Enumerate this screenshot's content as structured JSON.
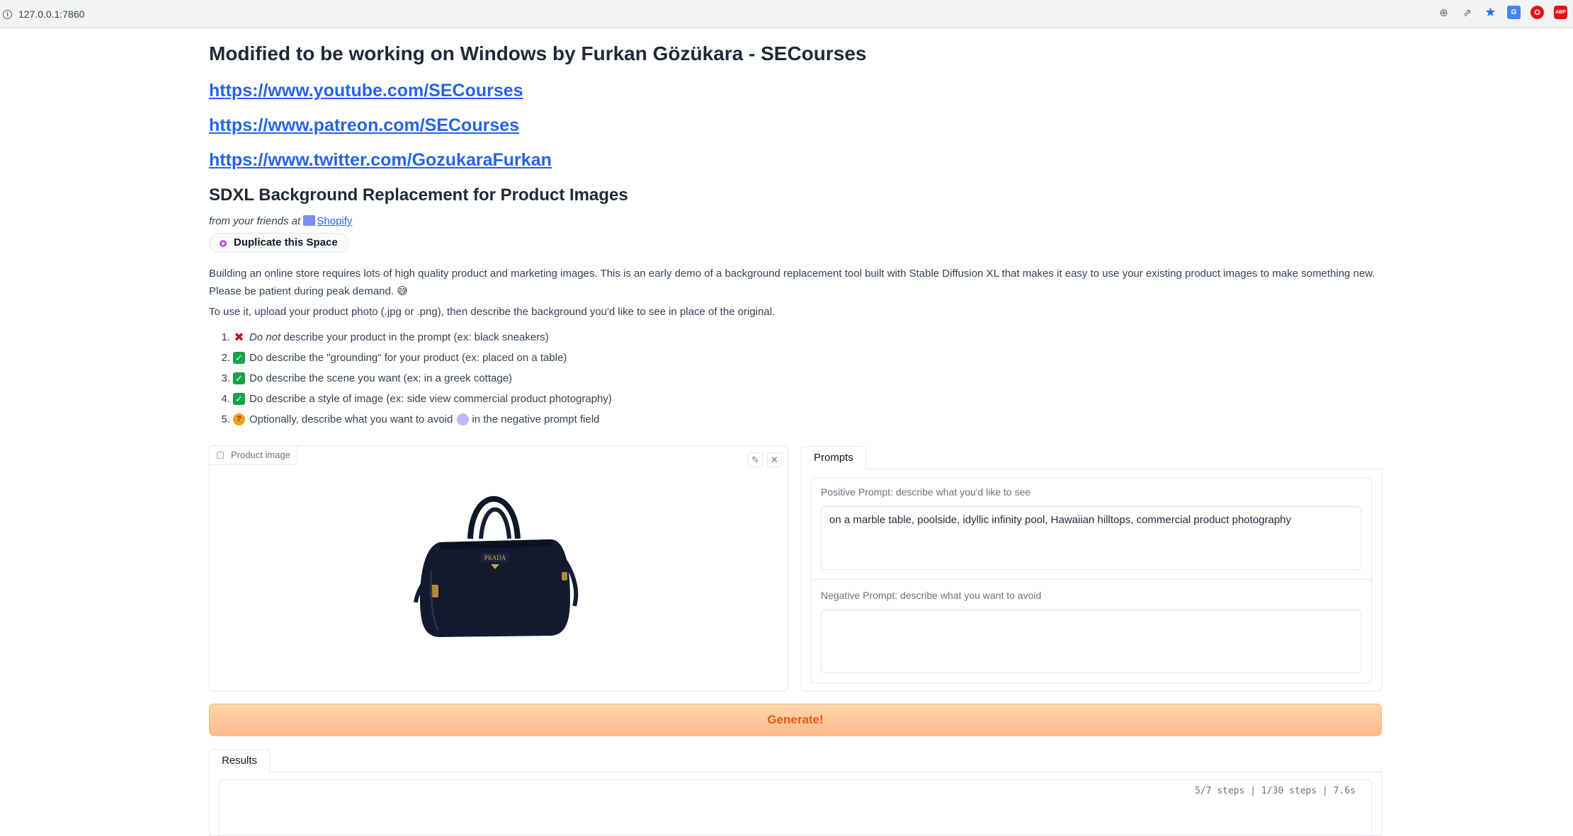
{
  "browser": {
    "url": "127.0.0.1:7860",
    "icons": [
      "zoom-icon",
      "share-icon",
      "bookmark-star-icon",
      "translate-extension-icon",
      "opera-extension-icon",
      "adblock-extension-icon"
    ]
  },
  "header": {
    "title": "Modified to be working on Windows by Furkan Gözükara - SECourses",
    "links": [
      "https://www.youtube.com/SECourses",
      "https://www.patreon.com/SECourses",
      "https://www.twitter.com/GozukaraFurkan"
    ]
  },
  "intro": {
    "heading": "SDXL Background Replacement for Product Images",
    "friends_prefix": "from your friends at",
    "friends_link": "Shopify",
    "duplicate_label": "Duplicate this Space",
    "description": "Building an online store requires lots of high quality product and marketing images. This is an early demo of a background replacement tool built with Stable Diffusion XL that makes it easy to use your existing product images to make something new. Please be patient during peak demand. 😅",
    "usage": "To use it, upload your product photo (.jpg or .png), then describe the background you'd like to see in place of the original.",
    "steps": [
      {
        "num": "1.",
        "emphasis": "Do not",
        "text": " describe your product in the prompt (ex: black sneakers)"
      },
      {
        "num": "2.",
        "text": "Do describe the \"grounding\" for your product (ex: placed on a table)"
      },
      {
        "num": "3.",
        "text": "Do describe the scene you want (ex: in a greek cottage)"
      },
      {
        "num": "4.",
        "text": "Do describe a style of image (ex: side view commercial product photography)"
      },
      {
        "num": "5.",
        "text": "Optionally, describe what you want to avoid",
        "text_after": "in the negative prompt field"
      }
    ]
  },
  "image_panel": {
    "label": "Product image",
    "edit_icon": "pencil-icon",
    "clear_icon": "close-icon",
    "brand_text": "PRADA"
  },
  "prompts": {
    "tab_label": "Prompts",
    "positive_label": "Positive Prompt: describe what you'd like to see",
    "positive_value": "on a marble table, poolside, idyllic infinity pool, Hawaiian hilltops, commercial product photography",
    "negative_label": "Negative Prompt: describe what you want to avoid",
    "negative_value": ""
  },
  "generate_label": "Generate!",
  "results": {
    "tab_label": "Results",
    "progress": "5/7 steps | 1/30 steps | 7.6s"
  },
  "colors": {
    "link": "#2563eb",
    "generate_bg": "#fdba8c",
    "generate_text": "#ea580c"
  }
}
